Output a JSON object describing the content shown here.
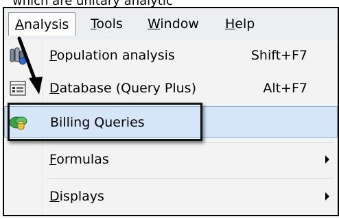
{
  "caption": "which are unitary analytic",
  "menubar": {
    "items": [
      {
        "label": "Analysis",
        "mnemonic": "A",
        "rest": "nalysis",
        "active": true
      },
      {
        "label": "Tools",
        "mnemonic": "T",
        "rest": "ools"
      },
      {
        "label": "Window",
        "mnemonic": "W",
        "rest": "indow"
      },
      {
        "label": "Help",
        "mnemonic": "H",
        "rest": "elp"
      }
    ]
  },
  "menu": {
    "items": [
      {
        "mnemonic": "P",
        "rest": "opulation analysis",
        "label": "Population analysis",
        "shortcut": "Shift+F7",
        "icon": "population-analysis-icon"
      },
      {
        "mnemonic": "D",
        "rest": "atabase (Query Plus)",
        "label": "Database (Query Plus)",
        "shortcut": "Alt+F7",
        "icon": "database-query-icon"
      },
      {
        "mnemonic": "",
        "rest": "Billing Queries",
        "label": "Billing Queries",
        "shortcut": "",
        "icon": "billing-queries-icon",
        "highlighted": true
      },
      {
        "mnemonic": "F",
        "rest": "ormulas",
        "label": "Formulas",
        "submenu": true
      },
      {
        "mnemonic": "D",
        "rest": "isplays",
        "label": "Displays",
        "submenu": true
      }
    ]
  },
  "colors": {
    "menubar_bg": "#eceef2",
    "menu_bg": "#f3f3f3",
    "highlight_bg": "#d4e6f8",
    "highlight_border": "#84acdd",
    "callout_border": "#111111"
  }
}
